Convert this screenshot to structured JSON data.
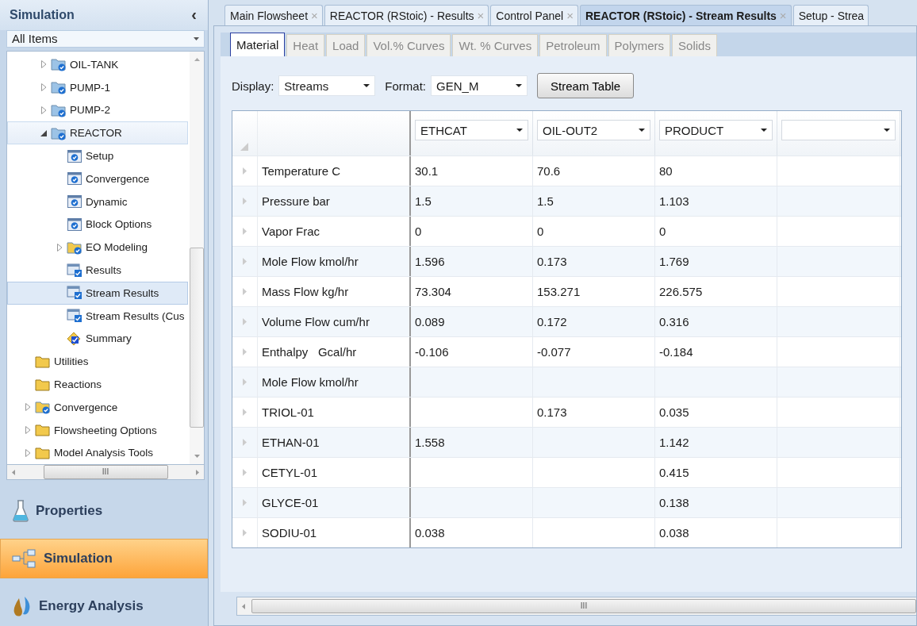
{
  "sidebar": {
    "title": "Simulation",
    "collapse_glyph": "‹",
    "filter": {
      "value": "All Items"
    },
    "tree": {
      "continued_items": [
        {
          "label": "OIL-TANK",
          "kind": "block",
          "expandable": true,
          "expanded": false,
          "selected": false
        },
        {
          "label": "PUMP-1",
          "kind": "block",
          "expandable": true,
          "expanded": false,
          "selected": false
        },
        {
          "label": "PUMP-2",
          "kind": "block",
          "expandable": true,
          "expanded": false,
          "selected": false
        },
        {
          "label": "REACTOR",
          "kind": "block",
          "expandable": true,
          "expanded": true,
          "selected": false,
          "highlighted": true,
          "children": [
            {
              "label": "Setup",
              "kind": "form",
              "expandable": false,
              "selected": false
            },
            {
              "label": "Convergence",
              "kind": "form",
              "expandable": false,
              "selected": false
            },
            {
              "label": "Dynamic",
              "kind": "form",
              "expandable": false,
              "selected": false
            },
            {
              "label": "Block Options",
              "kind": "form",
              "expandable": false,
              "selected": false
            },
            {
              "label": "EO Modeling",
              "kind": "folder-check",
              "expandable": true,
              "expanded": false,
              "selected": false
            },
            {
              "label": "Results",
              "kind": "results",
              "expandable": false,
              "selected": false
            },
            {
              "label": "Stream Results",
              "kind": "results",
              "expandable": false,
              "selected": true
            },
            {
              "label": "Stream Results (Cus",
              "kind": "results",
              "expandable": false,
              "selected": false
            },
            {
              "label": "Summary",
              "kind": "summary",
              "expandable": false,
              "selected": false
            }
          ]
        }
      ],
      "items": [
        {
          "label": "Utilities",
          "kind": "folder",
          "expandable": false,
          "selected": false
        },
        {
          "label": "Reactions",
          "kind": "folder",
          "expandable": false,
          "selected": false
        },
        {
          "label": "Convergence",
          "kind": "folder-check",
          "expandable": true,
          "expanded": false,
          "selected": false
        },
        {
          "label": "Flowsheeting Options",
          "kind": "folder",
          "expandable": true,
          "expanded": false,
          "selected": false
        },
        {
          "label": "Model Analysis Tools",
          "kind": "folder",
          "expandable": true,
          "expanded": false,
          "selected": false
        }
      ]
    },
    "scrollbar_grip": "III",
    "nav": [
      {
        "label": "Properties",
        "kind": "flask",
        "selected": false
      },
      {
        "label": "Simulation",
        "kind": "diagram",
        "selected": true
      },
      {
        "label": "Energy Analysis",
        "kind": "drops",
        "selected": false
      }
    ]
  },
  "document_tabs": [
    {
      "label": "Main Flowsheet",
      "closable": true,
      "selected": false
    },
    {
      "label": "REACTOR (RStoic) - Results",
      "closable": true,
      "selected": false
    },
    {
      "label": "Control Panel",
      "closable": true,
      "selected": false
    },
    {
      "label": "REACTOR (RStoic) - Stream Results",
      "closable": true,
      "selected": true
    },
    {
      "label": "Setup - Strea",
      "closable": false,
      "selected": false
    }
  ],
  "close_glyph": "×",
  "sheet_tabs": [
    {
      "label": "Material",
      "selected": true
    },
    {
      "label": "Heat",
      "selected": false
    },
    {
      "label": "Load",
      "selected": false
    },
    {
      "label": "Vol.% Curves",
      "selected": false
    },
    {
      "label": "Wt. % Curves",
      "selected": false
    },
    {
      "label": "Petroleum",
      "selected": false
    },
    {
      "label": "Polymers",
      "selected": false
    },
    {
      "label": "Solids",
      "selected": false
    }
  ],
  "toolbar": {
    "display_label": "Display:",
    "display_value": "Streams",
    "format_label": "Format:",
    "format_value": "GEN_M",
    "button": "Stream Table"
  },
  "table": {
    "columns": [
      {
        "kind": "dropdown",
        "value": "ETHCAT"
      },
      {
        "kind": "dropdown",
        "value": "OIL-OUT2"
      },
      {
        "kind": "dropdown",
        "value": "PRODUCT"
      },
      {
        "kind": "dropdown"
      }
    ],
    "rows": [
      {
        "label": "Temperature C",
        "cells": [
          {
            "kind": "value",
            "value": "30.1"
          },
          {
            "kind": "value",
            "value": "70.6"
          },
          {
            "kind": "value",
            "value": "80"
          }
        ]
      },
      {
        "label": "Pressure bar",
        "cells": [
          {
            "kind": "value",
            "value": "1.5"
          },
          {
            "kind": "value",
            "value": "1.5"
          },
          {
            "kind": "value",
            "value": "1.103"
          }
        ]
      },
      {
        "label": "Vapor Frac",
        "cells": [
          {
            "kind": "value",
            "value": "0"
          },
          {
            "kind": "value",
            "value": "0"
          },
          {
            "kind": "value",
            "value": "0"
          }
        ]
      },
      {
        "label": "Mole Flow kmol/hr",
        "cells": [
          {
            "kind": "value",
            "value": "1.596"
          },
          {
            "kind": "value",
            "value": "0.173"
          },
          {
            "kind": "value",
            "value": "1.769"
          }
        ]
      },
      {
        "label": "Mass Flow kg/hr",
        "cells": [
          {
            "kind": "value",
            "value": "73.304"
          },
          {
            "kind": "value",
            "value": "153.271"
          },
          {
            "kind": "value",
            "value": "226.575"
          }
        ]
      },
      {
        "label": "Volume Flow cum/hr",
        "cells": [
          {
            "kind": "value",
            "value": "0.089"
          },
          {
            "kind": "value",
            "value": "0.172"
          },
          {
            "kind": "value",
            "value": "0.316"
          }
        ]
      },
      {
        "label": "Enthalpy   Gcal/hr",
        "cells": [
          {
            "kind": "value",
            "value": "-0.106"
          },
          {
            "kind": "value",
            "value": "-0.077"
          },
          {
            "kind": "value",
            "value": "-0.184"
          }
        ]
      },
      {
        "label": "Mole Flow kmol/hr",
        "cells": [
          {
            "kind": "blank"
          },
          {
            "kind": "blank"
          },
          {
            "kind": "blank"
          }
        ]
      },
      {
        "label": "TRIOL-01",
        "cells": [
          {
            "kind": "blank"
          },
          {
            "kind": "value",
            "value": "0.173"
          },
          {
            "kind": "value",
            "value": "0.035"
          }
        ]
      },
      {
        "label": "ETHAN-01",
        "cells": [
          {
            "kind": "value",
            "value": "1.558"
          },
          {
            "kind": "blank"
          },
          {
            "kind": "value",
            "value": "1.142"
          }
        ]
      },
      {
        "label": "CETYL-01",
        "cells": [
          {
            "kind": "blank"
          },
          {
            "kind": "blank"
          },
          {
            "kind": "value",
            "value": "0.415"
          }
        ]
      },
      {
        "label": "GLYCE-01",
        "cells": [
          {
            "kind": "blank"
          },
          {
            "kind": "blank"
          },
          {
            "kind": "value",
            "value": "0.138"
          }
        ]
      },
      {
        "label": "SODIU-01",
        "cells": [
          {
            "kind": "value",
            "value": "0.038"
          },
          {
            "kind": "blank"
          },
          {
            "kind": "value",
            "value": "0.038"
          }
        ]
      }
    ],
    "scrollbar_grip": "III"
  }
}
